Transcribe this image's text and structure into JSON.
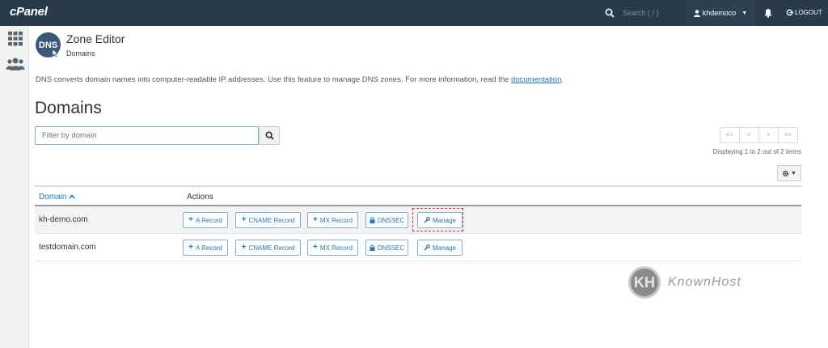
{
  "header": {
    "brand": "cPanel",
    "search_placeholder": "Search ( / )",
    "username": "khdemoco",
    "logout_label": "LOGOUT"
  },
  "app": {
    "icon_text": "DNS",
    "title": "Zone Editor",
    "breadcrumb": "Domains",
    "description": "DNS converts domain names into computer-readable IP addresses. Use this feature to manage DNS zones. For more information, read the ",
    "doc_link": "documentation",
    "desc_end": ".",
    "heading": "Domains"
  },
  "filter": {
    "placeholder": "Filter by domain"
  },
  "pagination": {
    "first": "<<",
    "prev": "<",
    "next": ">",
    "last": ">>",
    "status": "Displaying 1 to 2 out of 2 items"
  },
  "table": {
    "col_domain": "Domain",
    "col_actions": "Actions",
    "action_labels": {
      "a": "A Record",
      "cname": "CNAME Record",
      "mx": "MX Record",
      "dnssec": "DNSSEC",
      "manage": "Manage"
    },
    "rows": [
      {
        "domain": "kh-demo.com"
      },
      {
        "domain": "testdomain.com"
      }
    ]
  },
  "watermark": {
    "logo_text": "KH",
    "name": "KnownHost"
  },
  "colors": {
    "topbar": "#293a4a",
    "link": "#1e78bf",
    "highlight": "#d12b3a"
  }
}
